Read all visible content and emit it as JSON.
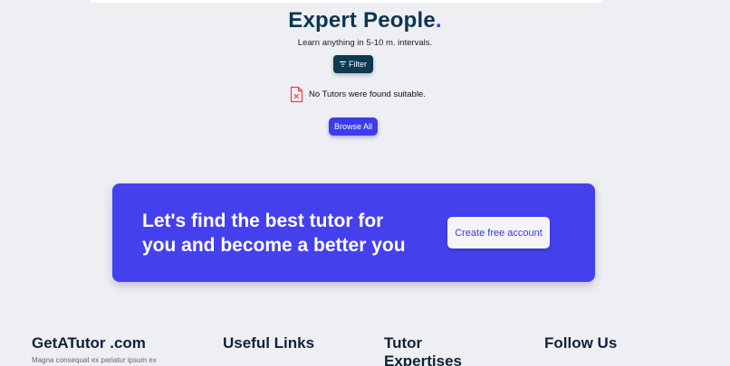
{
  "hero": {
    "title_main": "Expert People",
    "title_dot": ".",
    "subtitle": "Learn anything in 5-10 m. intervals."
  },
  "filter": {
    "label": "Filter",
    "icon": "filter-icon"
  },
  "empty_state": {
    "message": "No Tutors were found suitable.",
    "icon": "file-x-icon"
  },
  "browse": {
    "label": "Browse All"
  },
  "cta": {
    "line1": "Let's find the best tutor for",
    "line2": "you and become a better you",
    "button_label": "Create free account"
  },
  "footer": {
    "brand": "GetATutor .com",
    "brand_text": "Magna consequat ex pariatur ipsum ex",
    "col_useful": "Useful Links",
    "col_tutor_line1": "Tutor",
    "col_tutor_line2": "Expertises",
    "col_follow": "Follow Us"
  },
  "colors": {
    "background": "#eeeff3",
    "primary": "#4540ee",
    "dark": "#0b3a52",
    "error": "#e04848"
  }
}
